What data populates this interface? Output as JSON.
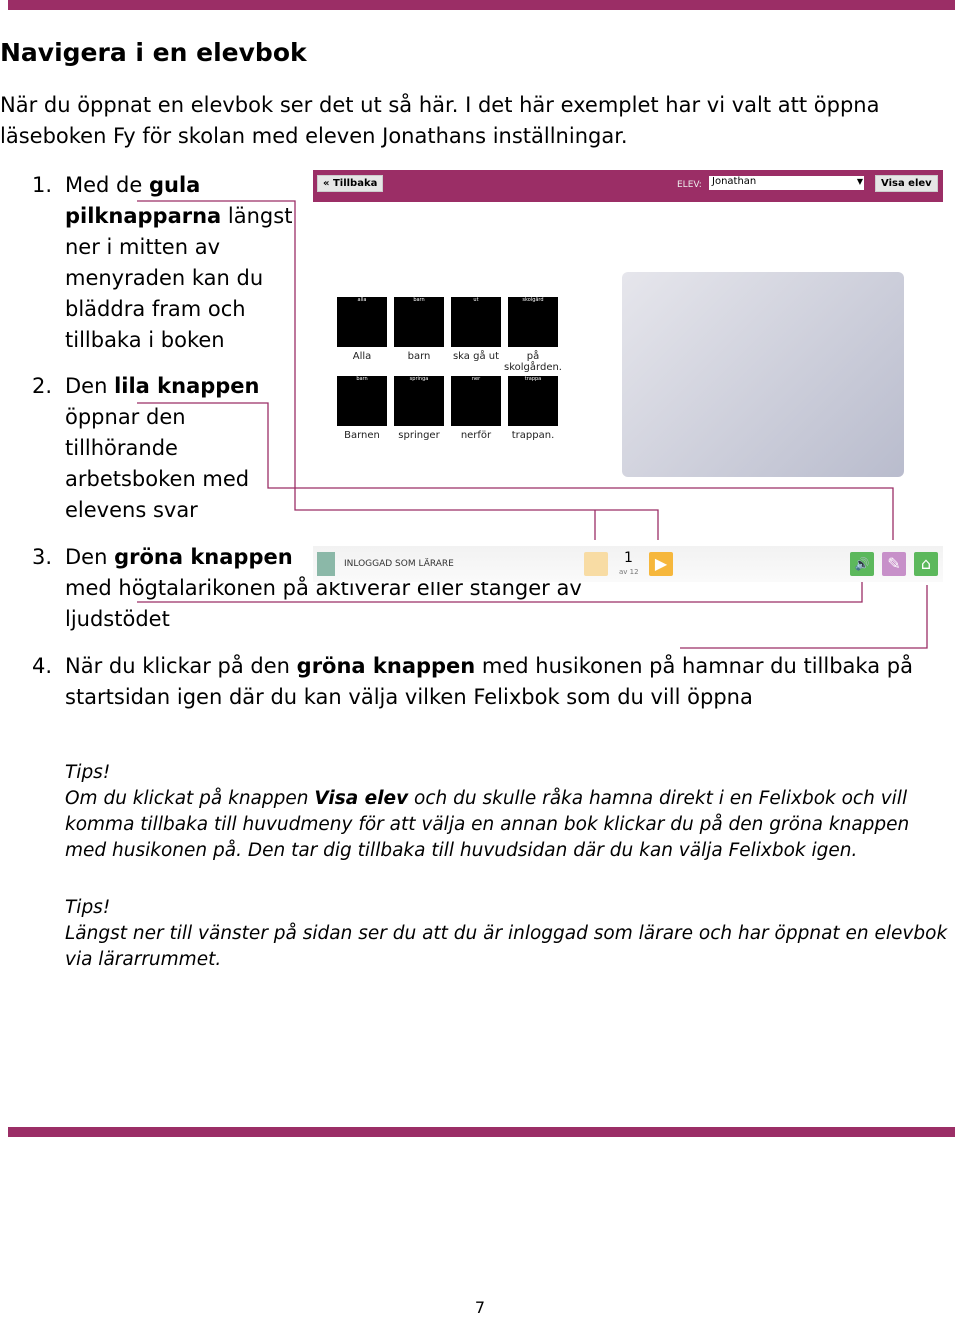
{
  "title": "Navigera i en elevbok",
  "intro": "När du öppnat en elevbok ser det ut så här. I det här exemplet har vi valt att öppna läseboken Fy för skolan med eleven Jonathans inställningar.",
  "items": [
    {
      "num": "1.",
      "pre": "Med de ",
      "bold": "gula pilknapparna",
      "post": " längst ner i mitten av menyraden kan du bläddra fram och tillbaka i boken"
    },
    {
      "num": "2.",
      "pre": "Den ",
      "bold": "lila knappen",
      "post": " öppnar den tillhörande arbetsboken med elevens svar"
    },
    {
      "num": "3.",
      "pre": "Den ",
      "bold": "gröna knappen",
      "post": " med högtalarikonen på aktiverar eller stänger av ljudstödet"
    },
    {
      "num": "4.",
      "pre": "När du klickar på den ",
      "bold": "gröna knappen",
      "post": " med husikonen på hamnar du tillbaka på startsidan igen där du kan välja vilken Felixbok som du vill öppna"
    }
  ],
  "app": {
    "back": "« Tillbaka",
    "elev_label": "ELEV:",
    "elev_value": "Jonathan",
    "show": "Visa elev",
    "symbols": [
      {
        "top": "alla",
        "label": "Alla"
      },
      {
        "top": "barn",
        "label": "barn"
      },
      {
        "top": "ut",
        "label": "ska gå ut"
      },
      {
        "top": "skolgård",
        "label": "på skolgården."
      },
      {
        "top": "barn",
        "label": "Barnen"
      },
      {
        "top": "springa",
        "label": "springer"
      },
      {
        "top": "ner",
        "label": "nerför"
      },
      {
        "top": "trappa",
        "label": "trappan."
      }
    ],
    "logged": "INLOGGAD SOM LÄRARE",
    "page": "1",
    "of": "av 12"
  },
  "tips1": {
    "head": "Tips!",
    "pre": "Om du klickat på knappen ",
    "bold": "Visa elev",
    "post": " och du skulle råka hamna direkt i en Felixbok och vill komma tillbaka till huvudmeny för att välja en annan bok klickar du på den gröna knappen med husikonen på. Den tar dig tillbaka till huvudsidan där du kan välja Felixbok igen."
  },
  "tips2": {
    "head": "Tips!",
    "text": "Längst ner till vänster på sidan ser du att du är inloggad som lärare och har öppnat en elevbok via lärarrummet."
  },
  "page_number": "7",
  "colors": {
    "accent": "#9b2e66"
  }
}
